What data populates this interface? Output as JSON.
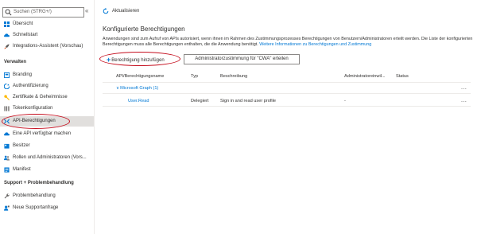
{
  "sidebar": {
    "search_placeholder": "Suchen (STRG+/)",
    "collapse_glyph": "«",
    "items_top": [
      {
        "label": "Übersicht",
        "icon": "grid-icon"
      },
      {
        "label": "Schnellstart",
        "icon": "cloud-icon"
      },
      {
        "label": "Integrations-Assistent (Vorschau)",
        "icon": "rocket-icon"
      }
    ],
    "section_manage": "Verwalten",
    "items_manage": [
      {
        "label": "Branding",
        "icon": "branding-icon"
      },
      {
        "label": "Authentifizierung",
        "icon": "authentication-icon"
      },
      {
        "label": "Zertifikate & Geheimnisse",
        "icon": "key-icon"
      },
      {
        "label": "Tokenkonfiguration",
        "icon": "token-icon"
      },
      {
        "label": "API-Berechtigungen",
        "icon": "api-permissions-icon"
      },
      {
        "label": "Eine API verfügbar machen",
        "icon": "cloud-api-icon"
      },
      {
        "label": "Besitzer",
        "icon": "owners-icon"
      },
      {
        "label": "Rollen und Administratoren (Vors...",
        "icon": "roles-icon"
      },
      {
        "label": "Manifest",
        "icon": "manifest-icon"
      }
    ],
    "section_support": "Support + Problembehandlung",
    "items_support": [
      {
        "label": "Problembehandlung",
        "icon": "wrench-icon"
      },
      {
        "label": "Neue Supportanfrage",
        "icon": "support-request-icon"
      }
    ],
    "selected_item": "API-Berechtigungen"
  },
  "toolbar": {
    "refresh_label": "Aktualisieren",
    "refresh_icon": "refresh-icon"
  },
  "main": {
    "title": "Konfigurierte Berechtigungen",
    "description": "Anwendungen sind zum Aufruf von APIs autorisiert, wenn ihnen im Rahmen des Zustimmungsprozesses Berechtigungen von Benutzern/Administratoren erteilt werden. Die Liste der konfigurierten Berechtigungen muss alle Berechtigungen enthalten, die die Anwendung benötigt.",
    "more_info_link": "Weitere Informationen zu Berechtigungen und Zustimmung",
    "add_permission_label": "Berechtigung hinzufügen",
    "grant_consent_label": "Administratorzustimmung für \"CWA\" erteilen"
  },
  "table": {
    "headers": [
      "API/Berechtigungsname",
      "Typ",
      "Beschreibung",
      "Administratoreinwil...",
      "Status"
    ],
    "group": {
      "label": "Microsoft Graph (1)",
      "more": "..."
    },
    "rows": [
      {
        "name": "User.Read",
        "type": "Delegiert",
        "description": "Sign in and read user profile",
        "admin_consent": "-",
        "status": "",
        "more": "..."
      }
    ]
  },
  "colors": {
    "accent": "#0078d4",
    "highlight_oval": "#c50f1f",
    "selected_bg": "#e1dfdd"
  }
}
